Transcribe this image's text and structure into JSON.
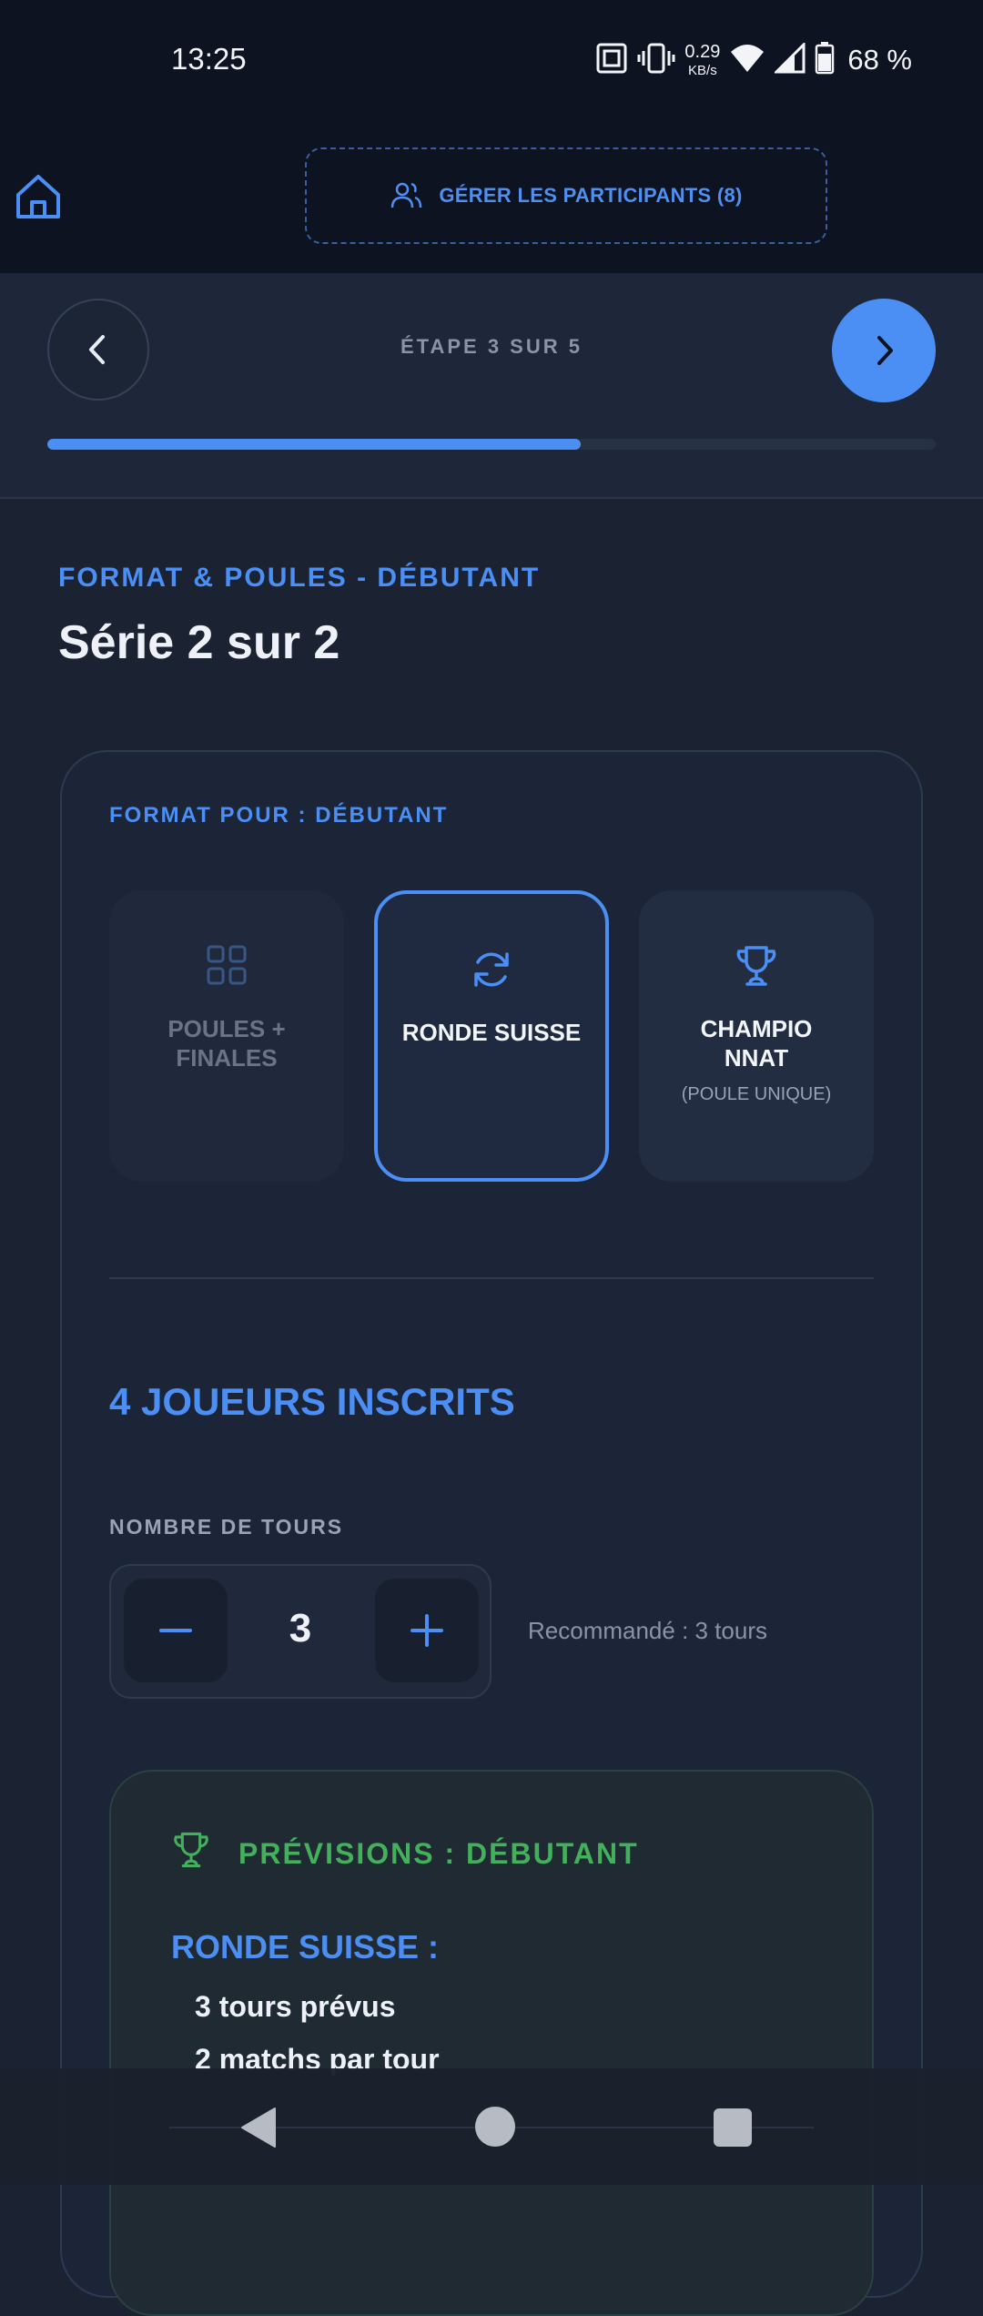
{
  "status_bar": {
    "time": "13:25",
    "net_speed_value": "0.29",
    "net_speed_unit": "KB/s",
    "battery": "68 %",
    "icons": [
      "nfc-icon",
      "vibrate-icon",
      "wifi-icon",
      "signal-icon",
      "battery-icon"
    ]
  },
  "header": {
    "home_icon": "home-icon",
    "manage_label": "GÉRER LES PARTICIPANTS (8)",
    "manage_icon": "users-icon"
  },
  "stepper_nav": {
    "step_label": "ÉTAPE 3 SUR 5",
    "progress_fraction": 0.6,
    "prev_icon": "chevron-left-icon",
    "next_icon": "chevron-right-icon"
  },
  "section": {
    "eyebrow": "FORMAT & POULES - DÉBUTANT",
    "title": "Série 2 sur 2"
  },
  "format": {
    "label": "FORMAT POUR : DÉBUTANT",
    "options": [
      {
        "label": "POULES + FINALES",
        "icon": "grid-icon",
        "state": "disabled"
      },
      {
        "label": "RONDE SUISSE",
        "icon": "refresh-icon",
        "state": "selected"
      },
      {
        "label": "CHAMPIO NNAT",
        "sub": "(POULE UNIQUE)",
        "icon": "trophy-icon",
        "state": "default"
      }
    ]
  },
  "players": {
    "count_label": "4 JOUEURS INSCRITS"
  },
  "tours": {
    "label": "NOMBRE DE TOURS",
    "value": "3",
    "recommendation": "Recommandé : 3 tours"
  },
  "forecast": {
    "title": "PRÉVISIONS : DÉBUTANT",
    "subtitle": "RONDE SUISSE :",
    "lines": [
      "3 tours prévus",
      "2 matchs par tour"
    ]
  },
  "colors": {
    "accent": "#4b8ff5",
    "success": "#43b05c",
    "background": "#1b2333",
    "header_bg": "#0d1320"
  }
}
